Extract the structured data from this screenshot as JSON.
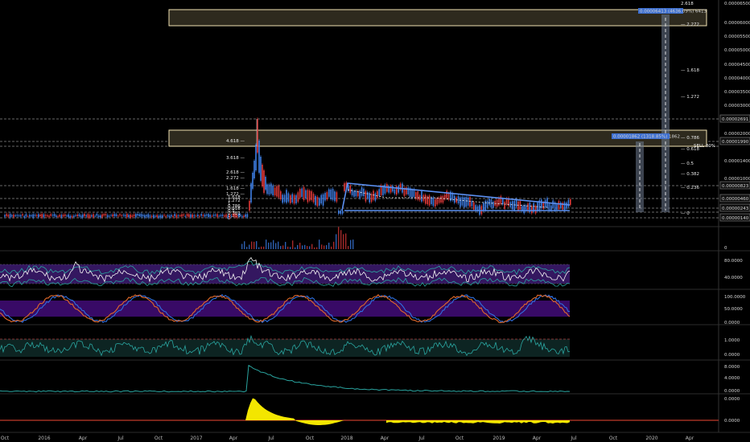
{
  "colors": {
    "background": "#000000",
    "up_candle": "#3f7fe6",
    "down_candle": "#e03a3a",
    "box_fill": "#2e2a1e",
    "box_stroke": "#f2e3b3",
    "trend_line": "#5b8ff0",
    "rsi_band": "#3a1a6a",
    "stoch_band": "#3b0b6b",
    "teal": "#2aa5a0",
    "yellow": "#f3e600",
    "red_line": "#c0392b"
  },
  "price_axis": {
    "ticks": [
      "0.00006500",
      "0.00006000",
      "0.00005500",
      "0.00005000",
      "0.00004500",
      "0.00004000",
      "0.00003500",
      "0.00003000",
      "0.00002500",
      "0.00002000",
      "0.00001400",
      "0.00001000"
    ],
    "badges": [
      "0.00002691",
      "0.00001990",
      "0.00000823",
      "0.00000460",
      "0.00000243",
      "0.00000140"
    ]
  },
  "fib_upper": [
    "2.618",
    "2.272",
    "1.618",
    "1.272"
  ],
  "fib_lower": [
    "0.786",
    "0.618",
    "0.5",
    "0.382",
    "0.236",
    "0"
  ],
  "fib_left_a": [
    "4.618",
    "3.618",
    "2.618",
    "2.272",
    "1.618",
    "1.272"
  ],
  "fib_left_b": [
    "1.618",
    "1.272",
    "1",
    "0.786",
    "0.618",
    "0.5",
    "0.382",
    "0.236",
    "0"
  ],
  "sell_label": "SELL 80%",
  "measure_upper": "0.00006413 (4636.09%) 6413",
  "measure_lower": "0.00001862 (1318.85%) 1862",
  "volume_axis": "0",
  "rsi_axis": [
    "80.0000",
    "40.0000"
  ],
  "stoch_axis": [
    "100.0000",
    "50.0000",
    "0.0000"
  ],
  "osc3_axis": [
    "1.0000",
    "0.0000"
  ],
  "osc4_axis": [
    "8.0000",
    "4.0000",
    "0.0000"
  ],
  "osc5_axis": [
    "0.0000",
    "0.0000"
  ],
  "time_axis": [
    "Oct",
    "2016",
    "Apr",
    "Jul",
    "Oct",
    "2017",
    "Apr",
    "Jul",
    "Oct",
    "2018",
    "Apr",
    "Jul",
    "Oct",
    "2019",
    "Apr",
    "Jul",
    "Oct",
    "2020",
    "Apr"
  ]
}
